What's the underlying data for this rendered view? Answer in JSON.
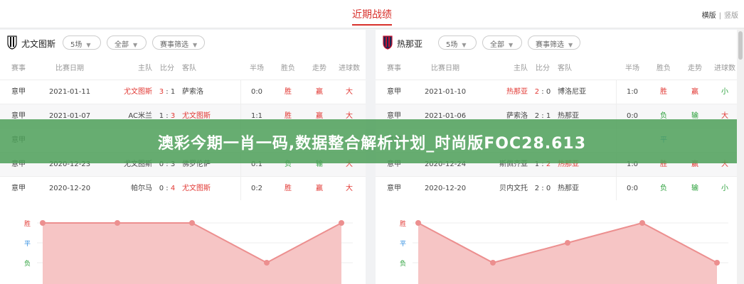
{
  "header": {
    "title": "近期战绩",
    "layout_labels": [
      "横版",
      "竖版"
    ]
  },
  "panels": [
    {
      "id": "left",
      "team": "尤文图斯",
      "logo_colors": [
        "#111111",
        "#ffffff"
      ],
      "filters": {
        "count": "5场",
        "scope": "全部",
        "filter": "赛事筛选"
      },
      "columns": [
        "赛事",
        "比赛日期",
        "主队",
        "比分",
        "客队",
        "半场",
        "胜负",
        "走势",
        "进球数"
      ],
      "rows": [
        {
          "league": "意甲",
          "date": "2021-01-11",
          "home": "尤文图斯",
          "score_home": "3",
          "score_away": "1",
          "away": "萨索洛",
          "half": "0:0",
          "result": "胜",
          "trend": "赢",
          "goals": "大",
          "home_hl": true,
          "away_hl": false,
          "result_c": "red",
          "trend_c": "red",
          "goals_c": "red"
        },
        {
          "league": "意甲",
          "date": "2021-01-07",
          "home": "AC米兰",
          "score_home": "1",
          "score_away": "3",
          "away": "尤文图斯",
          "half": "1:1",
          "result": "胜",
          "trend": "赢",
          "goals": "大",
          "home_hl": false,
          "away_hl": true,
          "result_c": "red",
          "trend_c": "red",
          "goals_c": "red"
        },
        {
          "league": "意甲",
          "date": "",
          "home": "",
          "score_home": "",
          "score_away": "",
          "away": "",
          "half": "",
          "result": "",
          "trend": "",
          "goals": "",
          "home_hl": false,
          "away_hl": false,
          "result_c": "red",
          "trend_c": "red",
          "goals_c": "red"
        },
        {
          "league": "意甲",
          "date": "2020-12-23",
          "home": "尤文图斯",
          "score_home": "0",
          "score_away": "3",
          "away": "佛罗伦萨",
          "half": "0:1",
          "result": "负",
          "trend": "输",
          "goals": "大",
          "home_hl": false,
          "away_hl": false,
          "result_c": "grn",
          "trend_c": "grn",
          "goals_c": "red"
        },
        {
          "league": "意甲",
          "date": "2020-12-20",
          "home": "帕尔马",
          "score_home": "0",
          "score_away": "4",
          "away": "尤文图斯",
          "half": "0:2",
          "result": "胜",
          "trend": "赢",
          "goals": "大",
          "home_hl": false,
          "away_hl": true,
          "result_c": "red",
          "trend_c": "red",
          "goals_c": "red"
        }
      ],
      "chart_data": {
        "type": "area",
        "x": [
          1,
          2,
          3,
          4,
          5
        ],
        "values": [
          3,
          3,
          3,
          1,
          3
        ],
        "y_labels": [
          "胜",
          "平",
          "负"
        ],
        "ylim": [
          1,
          3
        ],
        "fill": "#f6c5c5",
        "line": "#ec8f8f"
      }
    },
    {
      "id": "right",
      "team": "热那亚",
      "logo_colors": [
        "#c8102e",
        "#1b2a56"
      ],
      "filters": {
        "count": "5场",
        "scope": "全部",
        "filter": "赛事筛选"
      },
      "columns": [
        "赛事",
        "比赛日期",
        "主队",
        "比分",
        "客队",
        "半场",
        "胜负",
        "走势",
        "进球数"
      ],
      "rows": [
        {
          "league": "意甲",
          "date": "2021-01-10",
          "home": "热那亚",
          "score_home": "2",
          "score_away": "0",
          "away": "博洛尼亚",
          "half": "1:0",
          "result": "胜",
          "trend": "赢",
          "goals": "小",
          "home_hl": true,
          "away_hl": false,
          "result_c": "red",
          "trend_c": "red",
          "goals_c": "grn"
        },
        {
          "league": "意甲",
          "date": "2021-01-06",
          "home": "萨索洛",
          "score_home": "2",
          "score_away": "1",
          "away": "热那亚",
          "half": "0:0",
          "result": "负",
          "trend": "输",
          "goals": "大",
          "home_hl": false,
          "away_hl": false,
          "result_c": "grn",
          "trend_c": "grn",
          "goals_c": "red"
        },
        {
          "league": "意甲",
          "date": "",
          "home": "",
          "score_home": "",
          "score_away": "",
          "away": "",
          "half": "",
          "result": "平",
          "trend": "",
          "goals": "",
          "home_hl": false,
          "away_hl": false,
          "result_c": "blu",
          "trend_c": "red",
          "goals_c": "red"
        },
        {
          "league": "意甲",
          "date": "2020-12-24",
          "home": "斯佩齐亚",
          "score_home": "1",
          "score_away": "2",
          "away": "热那亚",
          "half": "1:0",
          "result": "胜",
          "trend": "赢",
          "goals": "大",
          "home_hl": false,
          "away_hl": true,
          "result_c": "red",
          "trend_c": "red",
          "goals_c": "red"
        },
        {
          "league": "意甲",
          "date": "2020-12-20",
          "home": "贝内文托",
          "score_home": "2",
          "score_away": "0",
          "away": "热那亚",
          "half": "0:0",
          "result": "负",
          "trend": "输",
          "goals": "小",
          "home_hl": false,
          "away_hl": false,
          "result_c": "grn",
          "trend_c": "grn",
          "goals_c": "grn"
        }
      ],
      "chart_data": {
        "type": "area",
        "x": [
          1,
          2,
          3,
          4,
          5
        ],
        "values": [
          3,
          1,
          2,
          3,
          1
        ],
        "y_labels": [
          "胜",
          "平",
          "负"
        ],
        "ylim": [
          1,
          3
        ],
        "fill": "#f6c5c5",
        "line": "#ec8f8f"
      }
    }
  ],
  "banner": {
    "text": "澳彩今期一肖一码,数据整合解析计划_时尚版FOC28.613",
    "color": "#4ea05a"
  }
}
